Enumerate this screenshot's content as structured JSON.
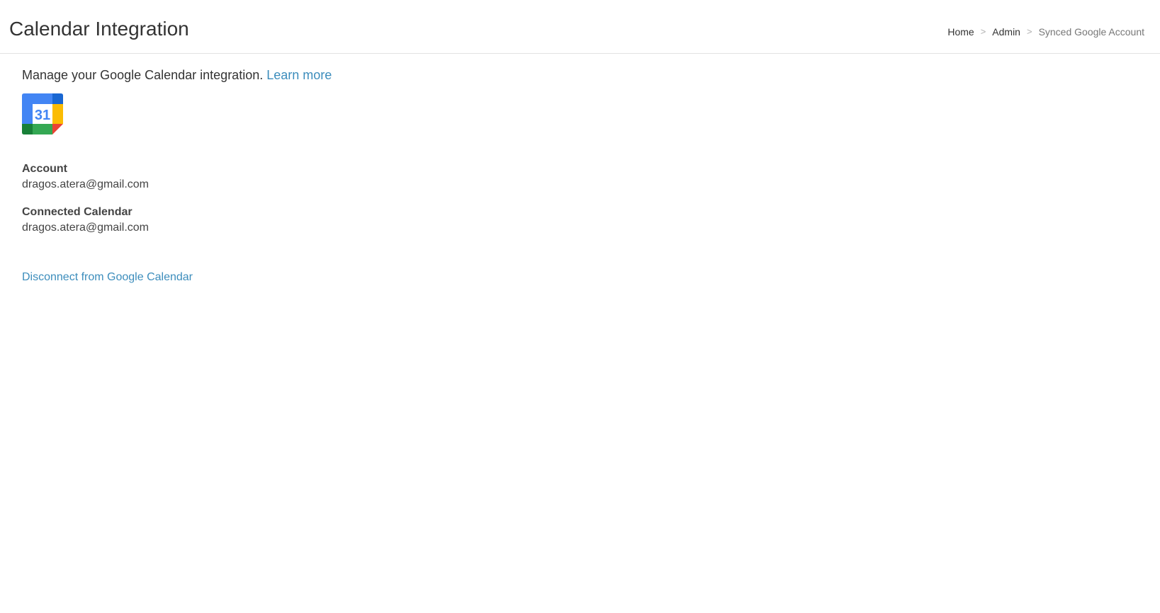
{
  "header": {
    "title": "Calendar Integration",
    "breadcrumb": [
      {
        "label": "Home"
      },
      {
        "label": "Admin"
      },
      {
        "label": "Synced Google Account"
      }
    ],
    "separator": ">"
  },
  "main": {
    "intro_text": "Manage your Google Calendar integration.",
    "learn_more_label": "Learn more",
    "logo": {
      "icon": "google-calendar-icon",
      "day_number": "31",
      "colors": {
        "blue": "#4285f4",
        "dark_blue": "#1967d2",
        "yellow": "#fbbc04",
        "green": "#34a853",
        "dark_green": "#188038",
        "red": "#ea4335"
      }
    },
    "fields": [
      {
        "label": "Account",
        "value": "dragos.atera@gmail.com"
      },
      {
        "label": "Connected Calendar",
        "value": "dragos.atera@gmail.com"
      }
    ],
    "disconnect_label": "Disconnect from Google Calendar"
  },
  "theme": {
    "link_color": "#3c8dbc",
    "text_color": "#333333"
  }
}
